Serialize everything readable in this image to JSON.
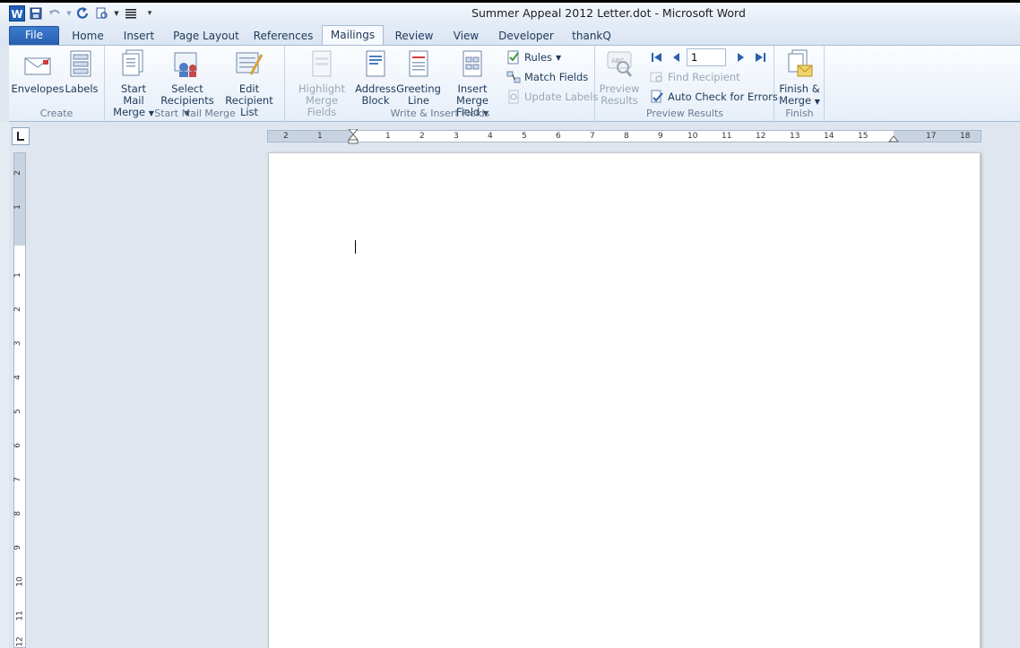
{
  "window": {
    "title": "Summer Appeal 2012 Letter.dot  -  Microsoft Word"
  },
  "qat": {
    "app_icon": "word-logo-icon",
    "app_letter": "W"
  },
  "tabs": [
    {
      "label": "File"
    },
    {
      "label": "Home"
    },
    {
      "label": "Insert"
    },
    {
      "label": "Page Layout"
    },
    {
      "label": "References"
    },
    {
      "label": "Mailings"
    },
    {
      "label": "Review"
    },
    {
      "label": "View"
    },
    {
      "label": "Developer"
    },
    {
      "label": "thankQ"
    }
  ],
  "ribbon": {
    "create": {
      "label": "Create",
      "envelopes": "Envelopes",
      "labels": "Labels"
    },
    "start_mail_merge": {
      "label": "Start Mail Merge",
      "start_l1": "Start Mail",
      "start_l2": "Merge",
      "select_l1": "Select",
      "select_l2": "Recipients",
      "edit_l1": "Edit",
      "edit_l2": "Recipient List"
    },
    "write_insert": {
      "label": "Write & Insert Fields",
      "highlight_l1": "Highlight",
      "highlight_l2": "Merge Fields",
      "address_l1": "Address",
      "address_l2": "Block",
      "greeting_l1": "Greeting",
      "greeting_l2": "Line",
      "insert_l1": "Insert Merge",
      "insert_l2": "Field",
      "rules": "Rules",
      "match_fields": "Match Fields",
      "update_labels": "Update Labels"
    },
    "preview": {
      "label": "Preview Results",
      "preview_l1": "Preview",
      "preview_l2": "Results",
      "record": "1",
      "find_recipient": "Find Recipient",
      "auto_check": "Auto Check for Errors"
    },
    "finish": {
      "label": "Finish",
      "finish_l1": "Finish &",
      "finish_l2": "Merge"
    }
  },
  "ruler": {
    "h_numbers": [
      "2",
      "1",
      "1",
      "2",
      "3",
      "4",
      "5",
      "6",
      "7",
      "8",
      "9",
      "10",
      "11",
      "12",
      "13",
      "14",
      "15",
      "17",
      "18"
    ],
    "v_numbers": [
      "2",
      "1",
      "1",
      "2",
      "3",
      "4",
      "5",
      "6",
      "7",
      "8",
      "9",
      "10",
      "11",
      "12"
    ]
  },
  "colors": {
    "accent": "#2a5fae",
    "ribbon_bg": "#f6f9fd",
    "workspace": "#dfe6ef"
  }
}
